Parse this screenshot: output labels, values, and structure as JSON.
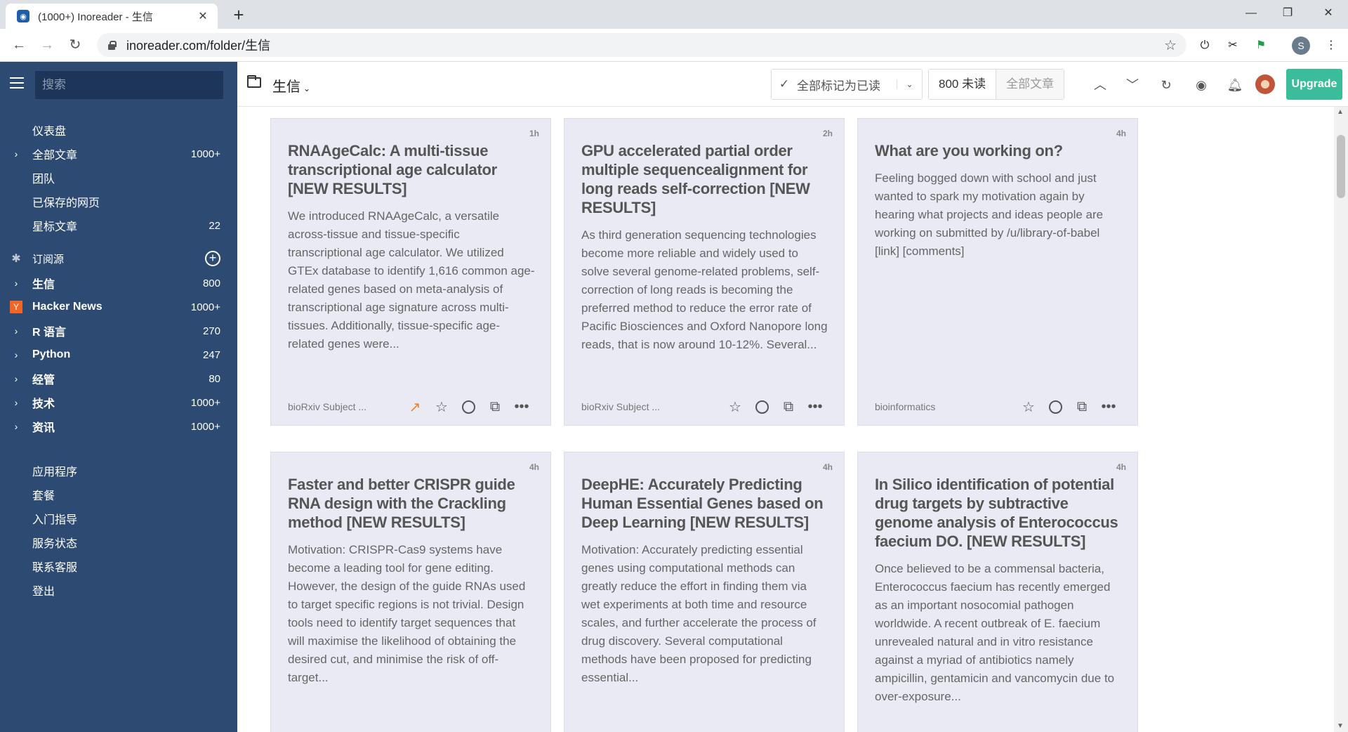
{
  "browser": {
    "tab_title": "(1000+) Inoreader - 生信",
    "url": "inoreader.com/folder/生信",
    "profile_initial": "S"
  },
  "sidebar": {
    "search_placeholder": "搜索",
    "top_items": [
      {
        "label": "仪表盘",
        "count": ""
      },
      {
        "label": "全部文章",
        "count": "1000+"
      },
      {
        "label": "团队",
        "count": ""
      },
      {
        "label": "已保存的网页",
        "count": ""
      },
      {
        "label": "星标文章",
        "count": "22"
      }
    ],
    "subscriptions_label": "订阅源",
    "feeds": [
      {
        "label": "生信",
        "count": "800"
      },
      {
        "label": "Hacker News",
        "count": "1000+"
      },
      {
        "label": "R 语言",
        "count": "270"
      },
      {
        "label": "Python",
        "count": "247"
      },
      {
        "label": "经管",
        "count": "80"
      },
      {
        "label": "技术",
        "count": "1000+"
      },
      {
        "label": "资讯",
        "count": "1000+"
      }
    ],
    "bottom_items": [
      "应用程序",
      "套餐",
      "入门指导",
      "服务状态",
      "联系客服",
      "登出"
    ]
  },
  "header": {
    "folder_title": "生信",
    "mark_all_read": "全部标记为已读",
    "unread_label": "800 未读",
    "all_articles_label": "全部文章",
    "upgrade_label": "Upgrade"
  },
  "articles": [
    {
      "age": "1h",
      "title": "RNAAgeCalc: A multi-tissue transcriptional age calculator [NEW RESULTS]",
      "desc": "We introduced RNAAgeCalc, a versatile across-tissue and tissue-specific transcriptional age calculator. We utilized GTEx database to identify 1,616 common age-related genes based on meta-analysis of transcriptional age signature across multi-tissues. Additionally, tissue-specific age-related genes were...",
      "source": "bioRxiv Subject ..."
    },
    {
      "age": "2h",
      "title": "GPU accelerated partial order multiple sequencealignment for long reads self-correction [NEW RESULTS]",
      "desc": "As third generation sequencing technologies become more reliable and widely used to solve several genome-related problems, self-correction of long reads is becoming the preferred method to reduce the error rate of Pacific Biosciences and Oxford Nanopore long reads, that is now around 10-12%. Several...",
      "source": "bioRxiv Subject ..."
    },
    {
      "age": "4h",
      "title": "What are you working on?",
      "desc": "Feeling bogged down with school and just wanted to spark my motivation again by hearing what projects and ideas people are working on submitted by /u/library-of-babel [link] [comments]",
      "source": "bioinformatics"
    },
    {
      "age": "4h",
      "title": "Faster and better CRISPR guide RNA design with the Crackling method [NEW RESULTS]",
      "desc": "Motivation: CRISPR-Cas9 systems have become a leading tool for gene editing. However, the design of the guide RNAs used to target specific regions is not trivial. Design tools need to identify target sequences that will maximise the likelihood of obtaining the desired cut, and minimise the risk of off-target...",
      "source": ""
    },
    {
      "age": "4h",
      "title": "DeepHE: Accurately Predicting Human Essential Genes based on Deep Learning [NEW RESULTS]",
      "desc": "Motivation: Accurately predicting essential genes using computational methods can greatly reduce the effort in finding them via wet experiments at both time and resource scales, and further accelerate the process of drug discovery. Several computational methods have been proposed for predicting essential...",
      "source": ""
    },
    {
      "age": "4h",
      "title": "In Silico identification of potential drug targets by subtractive genome analysis of Enterococcus faecium DO. [NEW RESULTS]",
      "desc": "Once believed to be a commensal bacteria, Enterococcus faecium has recently emerged as an important nosocomial pathogen worldwide. A recent outbreak of E. faecium unrevealed natural and in vitro resistance against a myriad of antibiotics namely ampicillin, gentamicin and vancomycin due to over-exposure...",
      "source": ""
    }
  ]
}
